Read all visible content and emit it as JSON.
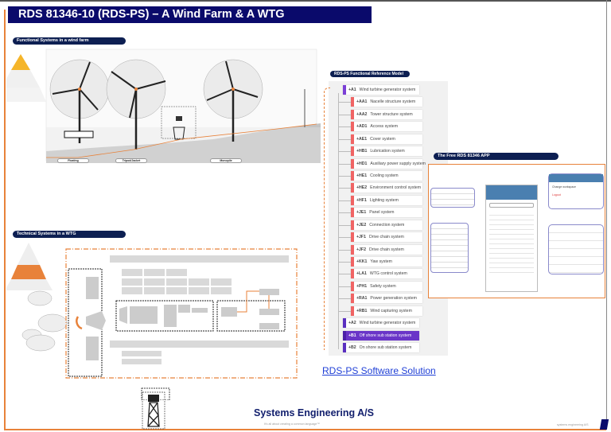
{
  "header": {
    "title": "RDS 81346-10 (RDS-PS) – A Wind Farm & A WTG"
  },
  "sections": {
    "wind_farm": "Functional Systems in a wind farm",
    "wtg": "Technical Systems in a WTG",
    "reference_model": "RDS-PS Functional Reference Model",
    "app": "The Free RDS 81346 APP"
  },
  "wind_farm": {
    "foundations": [
      "Floating",
      "Tripod/Jacket",
      "Monopile"
    ]
  },
  "tree": [
    {
      "code": "+A1",
      "label": "Wind turbine generator system",
      "level": 0,
      "color": "#7b3fd6"
    },
    {
      "code": "+AA1",
      "label": "Nacelle structure system",
      "level": 1
    },
    {
      "code": "+AA2",
      "label": "Tower structure system",
      "level": 1
    },
    {
      "code": "+AD1",
      "label": "Access system",
      "level": 1
    },
    {
      "code": "+AE1",
      "label": "Cover system",
      "level": 1
    },
    {
      "code": "+HB1",
      "label": "Lubrication system",
      "level": 1
    },
    {
      "code": "+HD1",
      "label": "Auxiliary power supply system",
      "level": 1
    },
    {
      "code": "+HE1",
      "label": "Cooling system",
      "level": 1
    },
    {
      "code": "+HE2",
      "label": "Environment control system",
      "level": 1
    },
    {
      "code": "+HF1",
      "label": "Lighting system",
      "level": 1
    },
    {
      "code": "+JE1",
      "label": "Panel system",
      "level": 1
    },
    {
      "code": "+JE2",
      "label": "Connection system",
      "level": 1
    },
    {
      "code": "+JF1",
      "label": "Drive chain system",
      "level": 1
    },
    {
      "code": "+JF2",
      "label": "Drive chain system",
      "level": 1
    },
    {
      "code": "+KK1",
      "label": "Yaw system",
      "level": 1
    },
    {
      "code": "+LA1",
      "label": "WTG control system",
      "level": 1
    },
    {
      "code": "+PH1",
      "label": "Safety system",
      "level": 1
    },
    {
      "code": "+RA1",
      "label": "Power generation system",
      "level": 1
    },
    {
      "code": "+RB1",
      "label": "Wind capturing system",
      "level": 1
    },
    {
      "code": "+A2",
      "label": "Wind turbine generator system",
      "level": 0
    },
    {
      "code": "+B1",
      "label": "Off shore sub station system",
      "level": 0,
      "selected": true
    },
    {
      "code": "+B2",
      "label": "On shore sub station system",
      "level": 0
    }
  ],
  "app": {
    "menu_items": [
      "Change workspace",
      "Logout"
    ]
  },
  "link": "RDS-PS Software Solution",
  "footer": {
    "brand": "Systems Engineering A/S",
    "tagline": "It's all about creating a common language™",
    "right": "systems engineering A/S"
  },
  "colors": {
    "navy": "#0a0a6b",
    "accent": "#e8823a",
    "link": "#1f3fd6",
    "selected": "#6a35c8",
    "marker": "#f06464"
  }
}
